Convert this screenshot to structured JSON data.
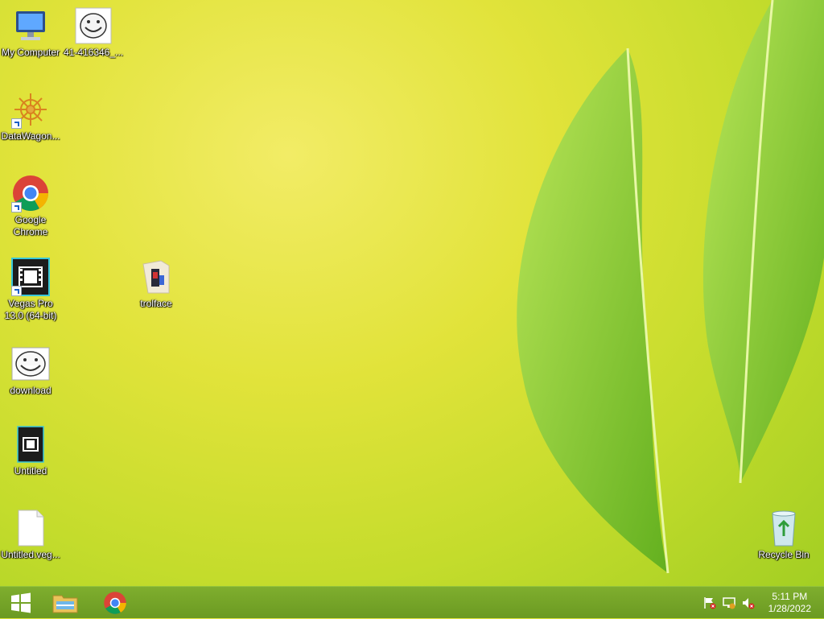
{
  "desktop_icons": [
    {
      "name": "my-computer",
      "label": "My Computer"
    },
    {
      "name": "image-file",
      "label": "41-416346_..."
    },
    {
      "name": "datawagon-shortcut",
      "label": "DataWagon..."
    },
    {
      "name": "google-chrome-shortcut",
      "label": "Google Chrome"
    },
    {
      "name": "vegas-pro-shortcut",
      "label": "Vegas Pro 13.0 (64-bit)"
    },
    {
      "name": "trollface-folder",
      "label": "trolface"
    },
    {
      "name": "download-image",
      "label": "download"
    },
    {
      "name": "untitled-project",
      "label": "Untitled"
    },
    {
      "name": "untitled-veg-file",
      "label": "Untitled.veg..."
    },
    {
      "name": "recycle-bin",
      "label": "Recycle Bin"
    }
  ],
  "taskbar": {
    "start_icon": "windows-logo-icon",
    "pinned": [
      "file-explorer-icon",
      "chrome-icon"
    ],
    "tray_icons": [
      "action-center-flag-icon",
      "network-icon",
      "volume-muted-icon"
    ],
    "clock": {
      "time": "5:11 PM",
      "date": "1/28/2022"
    }
  },
  "colors": {
    "taskbar": "#6b9a22",
    "wallpaper": "#d8e23a"
  }
}
